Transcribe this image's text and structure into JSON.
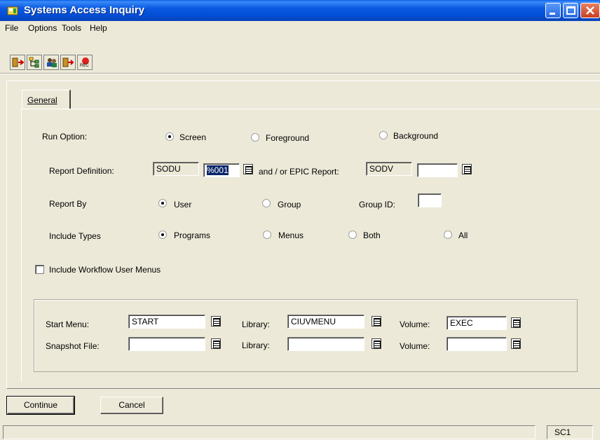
{
  "window": {
    "title": "Systems Access Inquiry"
  },
  "menu": [
    "File",
    "Options",
    "Tools",
    "Help"
  ],
  "toolbar": {
    "icons": [
      "exit-icon",
      "tree-icon",
      "people-icon",
      "run-icon",
      "record-icon"
    ],
    "record_label": "REC"
  },
  "tabs": {
    "general": "General"
  },
  "run_option": {
    "label": "Run Option:",
    "options": [
      "Screen",
      "Foreground",
      "Background"
    ],
    "selected": "Screen"
  },
  "report_definition": {
    "label": "Report Definition:",
    "value1": "SODU",
    "value2": "%001",
    "connector": "and / or EPIC Report:",
    "epic_value1": "SODV",
    "epic_value2": ""
  },
  "report_by": {
    "label": "Report By",
    "options": [
      "User",
      "Group"
    ],
    "selected": "User",
    "group_id_label": "Group ID:",
    "group_id_value": ""
  },
  "include_types": {
    "label": "Include Types",
    "options": [
      "Programs",
      "Menus",
      "Both",
      "All"
    ],
    "selected": "Programs"
  },
  "include_workflow": {
    "label": "Include Workflow User Menus",
    "checked": false
  },
  "start_menu": {
    "label": "Start Menu:",
    "value": "START",
    "library_label": "Library:",
    "library_value": "CIUVMENU",
    "volume_label": "Volume:",
    "volume_value": "EXEC"
  },
  "snapshot_file": {
    "label": "Snapshot File:",
    "value": "",
    "library_label": "Library:",
    "library_value": "",
    "volume_label": "Volume:",
    "volume_value": ""
  },
  "buttons": {
    "continue": "Continue",
    "cancel": "Cancel"
  },
  "status": {
    "cell": "SC1"
  },
  "colors": {
    "titlebar": "#0A58E0",
    "face": "#ECE9D8",
    "selection": "#0A246A"
  }
}
